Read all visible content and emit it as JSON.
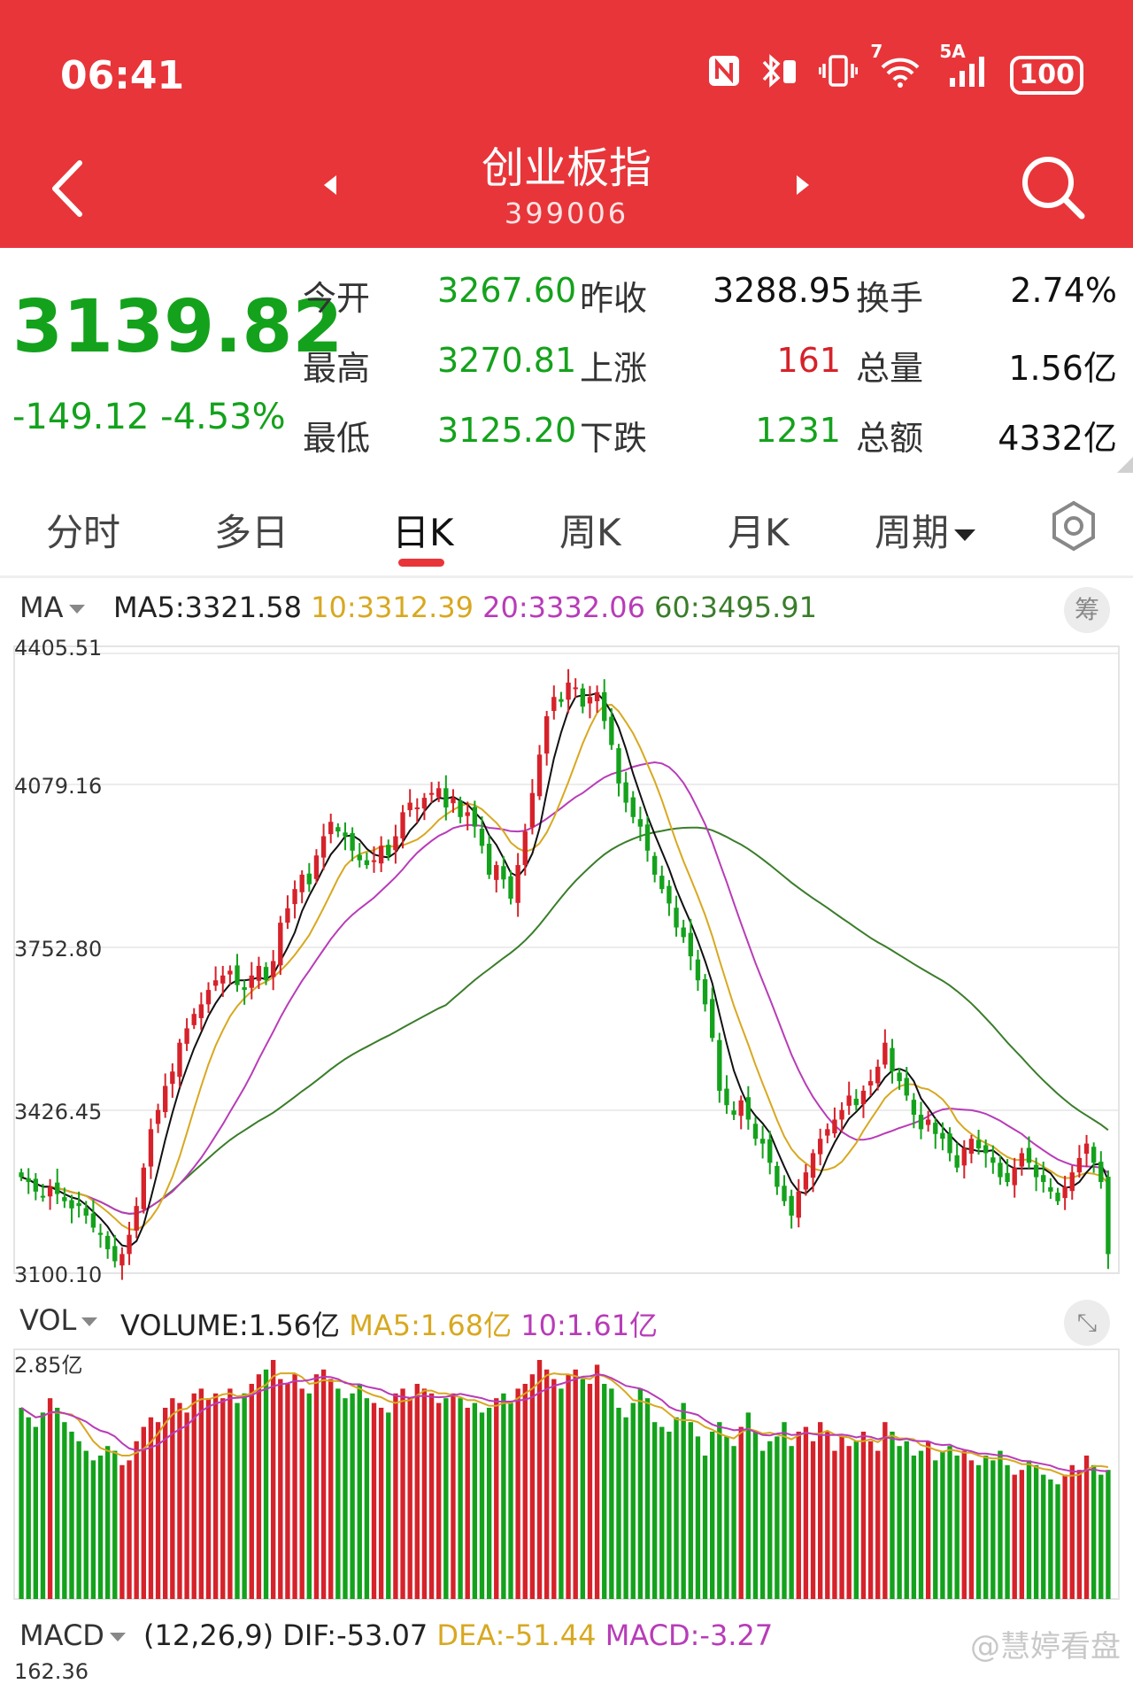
{
  "status_bar": {
    "time": "06:41",
    "icons": [
      "nfc-icon",
      "bluetooth-icon",
      "vibrate-icon",
      "wifi-icon",
      "signal-icon"
    ],
    "wifi_label": "7",
    "signal_label": "5A",
    "battery": "100"
  },
  "header": {
    "title": "创业板指",
    "code": "399006",
    "bg_color": "#e8353a"
  },
  "quote": {
    "price": "3139.82",
    "change": "-149.12",
    "change_pct": "-4.53%",
    "rows": [
      {
        "l1": "今开",
        "v1": "3267.60",
        "l2": "昨收",
        "v2": "3288.95",
        "l3": "换手",
        "v3": "2.74%"
      },
      {
        "l1": "最高",
        "v1": "3270.81",
        "l2": "上涨",
        "v2": "161",
        "l3": "总量",
        "v3": "1.56亿"
      },
      {
        "l1": "最低",
        "v1": "3125.20",
        "l2": "下跌",
        "v2": "1231",
        "l3": "总额",
        "v3": "4332亿"
      }
    ],
    "colors": {
      "up": "#d6222a",
      "down": "#14a21c"
    }
  },
  "tabs": [
    "分时",
    "多日",
    "日K",
    "周K",
    "月K",
    "周期"
  ],
  "active_tab": "日K",
  "ma": {
    "selector": "MA",
    "ma5": "MA5:3321.58",
    "ma10": "10:3312.39",
    "ma20": "20:3332.06",
    "ma60": "60:3495.91",
    "button": "筹"
  },
  "ma_colors": {
    "ma5": "#111111",
    "ma10": "#d8a820",
    "ma20": "#b83cb8",
    "ma60": "#3a7d2a"
  },
  "price_axis": [
    "4405.51",
    "4079.16",
    "3752.80",
    "3426.45",
    "3100.10"
  ],
  "volume": {
    "selector": "VOL",
    "volume": "VOLUME:1.56亿",
    "ma5": "MA5:1.68亿",
    "ma10": "10:1.61亿",
    "max_label": "2.85亿"
  },
  "macd": {
    "selector": "MACD",
    "params": "(12,26,9)",
    "dif": "DIF:-53.07",
    "dea": "DEA:-51.44",
    "macd": "MACD:-3.27",
    "tick": "162.36"
  },
  "watermark": "@慧婷看盘",
  "chart_data": {
    "type": "candlestick",
    "ylim": [
      3100.1,
      4405.51
    ],
    "close": [
      3300,
      3290,
      3270,
      3260,
      3280,
      3265,
      3250,
      3235,
      3240,
      3220,
      3195,
      3180,
      3150,
      3125,
      3140,
      3180,
      3240,
      3320,
      3400,
      3440,
      3490,
      3520,
      3580,
      3610,
      3640,
      3660,
      3690,
      3710,
      3720,
      3730,
      3700,
      3690,
      3720,
      3740,
      3710,
      3750,
      3830,
      3860,
      3900,
      3930,
      3910,
      3970,
      4010,
      4040,
      4020,
      4010,
      3980,
      3960,
      3950,
      3960,
      3990,
      3970,
      4010,
      4060,
      4080,
      4070,
      4090,
      4100,
      4110,
      4070,
      4090,
      4050,
      4060,
      4030,
      3990,
      3930,
      3950,
      3920,
      3880,
      3950,
      4020,
      4100,
      4180,
      4260,
      4300,
      4290,
      4330,
      4320,
      4280,
      4300,
      4310,
      4250,
      4200,
      4120,
      4080,
      4050,
      4030,
      3980,
      3930,
      3900,
      3870,
      3820,
      3800,
      3760,
      3710,
      3660,
      3590,
      3480,
      3450,
      3430,
      3460,
      3420,
      3380,
      3370,
      3330,
      3280,
      3250,
      3220,
      3270,
      3310,
      3350,
      3380,
      3400,
      3420,
      3440,
      3470,
      3450,
      3480,
      3500,
      3530,
      3580,
      3520,
      3500,
      3470,
      3430,
      3400,
      3420,
      3390,
      3380,
      3350,
      3320,
      3360,
      3380,
      3360,
      3350,
      3330,
      3300,
      3290,
      3320,
      3350,
      3330,
      3300,
      3290,
      3270,
      3250,
      3280,
      3310,
      3340,
      3370,
      3330,
      3290,
      3139.82
    ],
    "volume_ratio": [
      0.8,
      0.76,
      0.72,
      0.78,
      0.84,
      0.8,
      0.74,
      0.7,
      0.66,
      0.62,
      0.58,
      0.6,
      0.64,
      0.62,
      0.56,
      0.58,
      0.66,
      0.72,
      0.76,
      0.74,
      0.8,
      0.84,
      0.82,
      0.78,
      0.86,
      0.88,
      0.84,
      0.86,
      0.84,
      0.88,
      0.82,
      0.86,
      0.9,
      0.94,
      0.96,
      1.0,
      0.92,
      0.9,
      0.94,
      0.88,
      0.86,
      0.94,
      0.96,
      0.92,
      0.88,
      0.84,
      0.86,
      0.9,
      0.84,
      0.82,
      0.8,
      0.78,
      0.86,
      0.88,
      0.84,
      0.9,
      0.88,
      0.86,
      0.82,
      0.84,
      0.86,
      0.84,
      0.8,
      0.82,
      0.78,
      0.8,
      0.84,
      0.86,
      0.82,
      0.88,
      0.9,
      0.94,
      1.0,
      0.96,
      0.92,
      0.88,
      0.94,
      0.96,
      0.92,
      0.9,
      0.98,
      0.9,
      0.88,
      0.8,
      0.76,
      0.82,
      0.88,
      0.84,
      0.74,
      0.72,
      0.7,
      0.76,
      0.82,
      0.74,
      0.68,
      0.6,
      0.7,
      0.74,
      0.68,
      0.64,
      0.72,
      0.78,
      0.7,
      0.62,
      0.66,
      0.68,
      0.74,
      0.64,
      0.7,
      0.72,
      0.66,
      0.74,
      0.7,
      0.62,
      0.68,
      0.64,
      0.66,
      0.7,
      0.66,
      0.62,
      0.74,
      0.7,
      0.64,
      0.66,
      0.6,
      0.62,
      0.66,
      0.58,
      0.62,
      0.64,
      0.6,
      0.62,
      0.58,
      0.56,
      0.6,
      0.58,
      0.62,
      0.56,
      0.52,
      0.54,
      0.58,
      0.56,
      0.52,
      0.5,
      0.48,
      0.52,
      0.56,
      0.54,
      0.6,
      0.56,
      0.52,
      0.54
    ]
  }
}
